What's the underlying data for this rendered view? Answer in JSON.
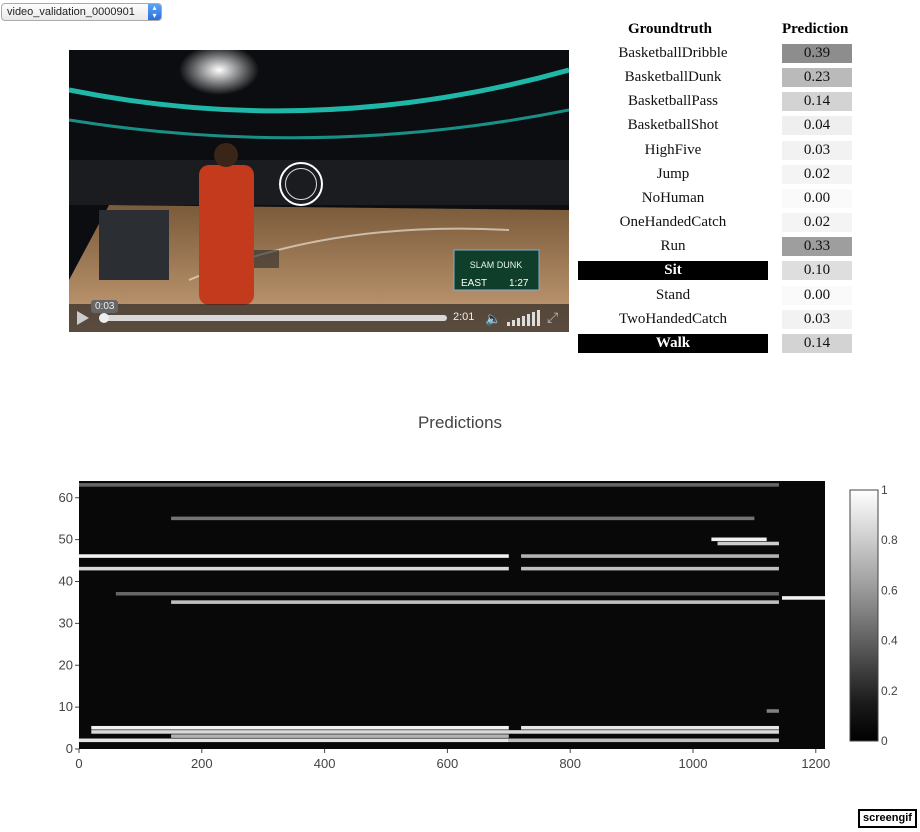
{
  "video_selector": {
    "value": "video_validation_0000901"
  },
  "video": {
    "current_time": "0:03",
    "duration": "2:01",
    "score_bug_line1": "SLAM DUNK",
    "score_bug_team": "EAST",
    "score_bug_clock": "1:27"
  },
  "table": {
    "col_groundtruth": "Groundtruth",
    "col_prediction": "Prediction",
    "rows": [
      {
        "label": "BasketballDribble",
        "value": "0.39",
        "active": false
      },
      {
        "label": "BasketballDunk",
        "value": "0.23",
        "active": false
      },
      {
        "label": "BasketballPass",
        "value": "0.14",
        "active": false
      },
      {
        "label": "BasketballShot",
        "value": "0.04",
        "active": false
      },
      {
        "label": "HighFive",
        "value": "0.03",
        "active": false
      },
      {
        "label": "Jump",
        "value": "0.02",
        "active": false
      },
      {
        "label": "NoHuman",
        "value": "0.00",
        "active": false
      },
      {
        "label": "OneHandedCatch",
        "value": "0.02",
        "active": false
      },
      {
        "label": "Run",
        "value": "0.33",
        "active": false
      },
      {
        "label": "Sit",
        "value": "0.10",
        "active": true
      },
      {
        "label": "Stand",
        "value": "0.00",
        "active": false
      },
      {
        "label": "TwoHandedCatch",
        "value": "0.03",
        "active": false
      },
      {
        "label": "Walk",
        "value": "0.14",
        "active": true
      }
    ]
  },
  "chart_data": {
    "type": "heatmap",
    "title": "Predictions",
    "xlim": [
      0,
      1215
    ],
    "ylim": [
      0,
      64
    ],
    "x_ticks": [
      "0",
      "200",
      "400",
      "600",
      "800",
      "1000",
      "1200"
    ],
    "y_ticks": [
      "0",
      "10",
      "20",
      "30",
      "40",
      "50",
      "60"
    ],
    "colorbar": {
      "min": 0,
      "max": 1,
      "ticks": [
        "0",
        "0.2",
        "0.4",
        "0.6",
        "0.8",
        "1"
      ]
    },
    "colorscale": "greys (black = 0, white = 1)",
    "bands": [
      {
        "row": 2,
        "x0": 0,
        "x1": 700,
        "v": 0.9
      },
      {
        "row": 2,
        "x0": 700,
        "x1": 1140,
        "v": 0.75
      },
      {
        "row": 3,
        "x0": 150,
        "x1": 700,
        "v": 0.7
      },
      {
        "row": 4,
        "x0": 20,
        "x1": 1140,
        "v": 0.85
      },
      {
        "row": 5,
        "x0": 20,
        "x1": 700,
        "v": 0.95
      },
      {
        "row": 5,
        "x0": 720,
        "x1": 1140,
        "v": 0.9
      },
      {
        "row": 9,
        "x0": 1120,
        "x1": 1140,
        "v": 0.5
      },
      {
        "row": 35,
        "x0": 150,
        "x1": 1140,
        "v": 0.75
      },
      {
        "row": 36,
        "x0": 1145,
        "x1": 1215,
        "v": 0.95
      },
      {
        "row": 37,
        "x0": 60,
        "x1": 1140,
        "v": 0.4
      },
      {
        "row": 43,
        "x0": 0,
        "x1": 700,
        "v": 0.85
      },
      {
        "row": 43,
        "x0": 720,
        "x1": 1140,
        "v": 0.75
      },
      {
        "row": 46,
        "x0": 0,
        "x1": 700,
        "v": 0.95
      },
      {
        "row": 46,
        "x0": 720,
        "x1": 1140,
        "v": 0.7
      },
      {
        "row": 49,
        "x0": 1040,
        "x1": 1140,
        "v": 0.8
      },
      {
        "row": 50,
        "x0": 1030,
        "x1": 1120,
        "v": 0.95
      },
      {
        "row": 55,
        "x0": 150,
        "x1": 1100,
        "v": 0.45
      },
      {
        "row": 63,
        "x0": 0,
        "x1": 1140,
        "v": 0.4
      }
    ]
  },
  "footer": {
    "badge": "screengif"
  }
}
